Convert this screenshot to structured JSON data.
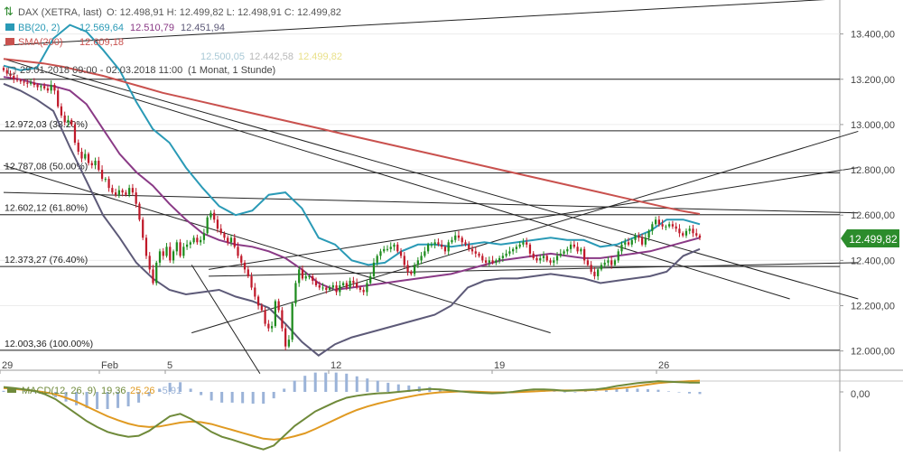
{
  "legend": {
    "instrument": "DAX (XETRA, last)",
    "ohlc": "O: 12.498,91  H: 12.499,82  L: 12.498,91  C: 12.499,82",
    "bb_label": "BB(20, 2)",
    "bb_values": [
      "12.569,64",
      "12.510,79",
      "12.451,94"
    ],
    "sma_label": "SMA(200)",
    "sma_value": "12.609,18",
    "faded_values": [
      "12.500,05",
      "12.442,58",
      "12.499,82"
    ],
    "range": "29.01.2018 09:00 - 02.03.2018 11:00",
    "period": "(1 Monat, 1 Stunde)"
  },
  "macd_legend": {
    "label": "MACD(12, 26, 9)",
    "values": [
      "19,36",
      "25,26",
      "-5,91"
    ]
  },
  "price_badge": "12.499,82",
  "colors": {
    "candle_up": "#1e8c1e",
    "candle_down": "#c0192a",
    "bb": "#2a9ab6",
    "bb_bands": "#5d5a78",
    "bb_mid": "#8a3a86",
    "sma": "#c9514e",
    "macd": "#6f8a3a",
    "signal": "#e09a22",
    "histogram": "#9bb3d8",
    "badge": "#2c8c2c"
  },
  "chart_data": {
    "type": "candlestick",
    "interval": "1 hour",
    "date_range": [
      "29.01.2018",
      "02.03.2018"
    ],
    "x_tick_labels": [
      "29",
      "Feb",
      "5",
      "12",
      "19",
      "26"
    ],
    "y_axis": {
      "ylim": [
        11915,
        13550
      ],
      "ticks": [
        12000,
        12200,
        12400,
        12600,
        12800,
        13000,
        13200,
        13400
      ],
      "tick_labels": [
        "12.000,00",
        "12.200,00",
        "12.400,00",
        "12.600,00",
        "12.800,00",
        "13.000,00",
        "13.200,00",
        "13.400,00"
      ]
    },
    "fibonacci_levels": [
      {
        "label": "12.003,36 (100.00%)",
        "value": 12003.36
      },
      {
        "label": "12.373,27 (76.40%)",
        "value": 12373.27
      },
      {
        "label": "12.602,12 (61.80%)",
        "value": 12602.12
      },
      {
        "label": "12.787,08 (50.00%)",
        "value": 12787.08
      },
      {
        "label": "12.972,03 (38.20%)",
        "value": 12972.03
      },
      {
        "label": "",
        "value": 13200
      }
    ],
    "close": [
      13240,
      13225,
      13215,
      13200,
      13195,
      13190,
      13185,
      13180,
      13185,
      13175,
      13165,
      13170,
      13160,
      13150,
      13175,
      13150,
      13080,
      13040,
      13010,
      13020,
      13000,
      12920,
      12880,
      12850,
      12870,
      12830,
      12820,
      12840,
      12800,
      12760,
      12760,
      12720,
      12700,
      12690,
      12710,
      12700,
      12690,
      12720,
      12700,
      12650,
      12580,
      12500,
      12420,
      12360,
      12300,
      12390,
      12440,
      12420,
      12460,
      12400,
      12440,
      12480,
      12420,
      12460,
      12470,
      12480,
      12500,
      12480,
      12490,
      12520,
      12590,
      12610,
      12580,
      12540,
      12520,
      12500,
      12480,
      12500,
      12460,
      12420,
      12390,
      12360,
      12330,
      12280,
      12240,
      12200,
      12180,
      12120,
      12100,
      12110,
      12220,
      12180,
      12100,
      12020,
      12050,
      12210,
      12300,
      12360,
      12320,
      12330,
      12330,
      12310,
      12290,
      12280,
      12280,
      12270,
      12280,
      12290,
      12260,
      12290,
      12300,
      12280,
      12310,
      12300,
      12280,
      12270,
      12260,
      12300,
      12330,
      12390,
      12420,
      12440,
      12450,
      12450,
      12460,
      12470,
      12440,
      12420,
      12380,
      12350,
      12340,
      12380,
      12400,
      12420,
      12440,
      12470,
      12470,
      12480,
      12470,
      12460,
      12440,
      12480,
      12490,
      12510,
      12500,
      12480,
      12470,
      12450,
      12440,
      12430,
      12420,
      12400,
      12390,
      12400,
      12390,
      12400,
      12410,
      12420,
      12430,
      12440,
      12450,
      12460,
      12470,
      12480,
      12470,
      12430,
      12410,
      12400,
      12410,
      12420,
      12400,
      12390,
      12400,
      12420,
      12430,
      12440,
      12450,
      12470,
      12460,
      12440,
      12450,
      12400,
      12380,
      12350,
      12330,
      12360,
      12380,
      12390,
      12400,
      12380,
      12400,
      12440,
      12470,
      12480,
      12470,
      12490,
      12510,
      12500,
      12470,
      12500,
      12530,
      12560,
      12580,
      12560,
      12550,
      12550,
      12560,
      12550,
      12540,
      12520,
      12510,
      12530,
      12540,
      12520,
      12510,
      12500
    ],
    "sma200": [
      13290,
      13280,
      13270,
      13255,
      13235,
      13215,
      13190,
      13165,
      13140,
      13120,
      13100,
      13080,
      13060,
      13040,
      13020,
      13000,
      12980,
      12960,
      12940,
      12920,
      12900,
      12880,
      12860,
      12840,
      12820,
      12800,
      12780,
      12760,
      12740,
      12720,
      12700,
      12680,
      12660,
      12640,
      12620,
      12605
    ],
    "bollinger": {
      "upper": [
        13260,
        13240,
        13250,
        13380,
        13440,
        13410,
        13330,
        13240,
        13100,
        12980,
        12920,
        12810,
        12720,
        12640,
        12600,
        12620,
        12690,
        12700,
        12630,
        12500,
        12470,
        12400,
        12380,
        12390,
        12440,
        12470,
        12470,
        12460,
        12470,
        12480,
        12470,
        12480,
        12490,
        12500,
        12490,
        12490,
        12460,
        12470,
        12500,
        12530,
        12580,
        12580,
        12560
      ],
      "middle": [
        13210,
        13200,
        13180,
        13170,
        13150,
        13090,
        12980,
        12870,
        12790,
        12730,
        12650,
        12580,
        12520,
        12490,
        12470,
        12460,
        12440,
        12410,
        12360,
        12300,
        12270,
        12280,
        12290,
        12300,
        12310,
        12320,
        12330,
        12340,
        12360,
        12380,
        12400,
        12410,
        12420,
        12430,
        12420,
        12410,
        12410,
        12420,
        12430,
        12440,
        12460,
        12480,
        12500
      ],
      "lower": [
        13180,
        13150,
        13110,
        13060,
        12900,
        12750,
        12600,
        12500,
        12390,
        12320,
        12270,
        12250,
        12260,
        12270,
        12240,
        12220,
        12190,
        12120,
        12040,
        11980,
        12030,
        12060,
        12080,
        12100,
        12120,
        12140,
        12160,
        12200,
        12280,
        12310,
        12320,
        12320,
        12330,
        12340,
        12330,
        12320,
        12300,
        12310,
        12320,
        12330,
        12350,
        12420,
        12450
      ]
    },
    "macd_panel": {
      "ytick_label": "0,00",
      "macd": [
        10,
        8,
        5,
        2,
        -5,
        -15,
        -30,
        -45,
        -60,
        -72,
        -82,
        -88,
        -92,
        -90,
        -80,
        -65,
        -50,
        -45,
        -55,
        -68,
        -82,
        -92,
        -98,
        -105,
        -112,
        -118,
        -110,
        -90,
        -70,
        -55,
        -40,
        -30,
        -20,
        -12,
        -8,
        -5,
        -3,
        -2,
        0,
        2,
        4,
        6,
        5,
        3,
        1,
        -1,
        -2,
        -3,
        -2,
        0,
        3,
        5,
        5,
        4,
        2,
        3,
        4,
        5,
        8,
        12,
        15,
        18,
        20,
        22,
        21,
        20,
        19,
        19
      ],
      "signal": [
        8,
        6,
        4,
        2,
        -1,
        -5,
        -12,
        -20,
        -30,
        -40,
        -50,
        -58,
        -65,
        -70,
        -72,
        -71,
        -67,
        -63,
        -61,
        -62,
        -66,
        -72,
        -78,
        -84,
        -90,
        -96,
        -98,
        -96,
        -91,
        -85,
        -76,
        -66,
        -56,
        -46,
        -37,
        -30,
        -24,
        -19,
        -14,
        -10,
        -6,
        -3,
        -1,
        0,
        1,
        1,
        0,
        -1,
        -1,
        -1,
        0,
        1,
        2,
        3,
        3,
        3,
        3,
        4,
        5,
        7,
        9,
        12,
        15,
        18,
        20,
        21,
        22,
        23
      ]
    }
  }
}
